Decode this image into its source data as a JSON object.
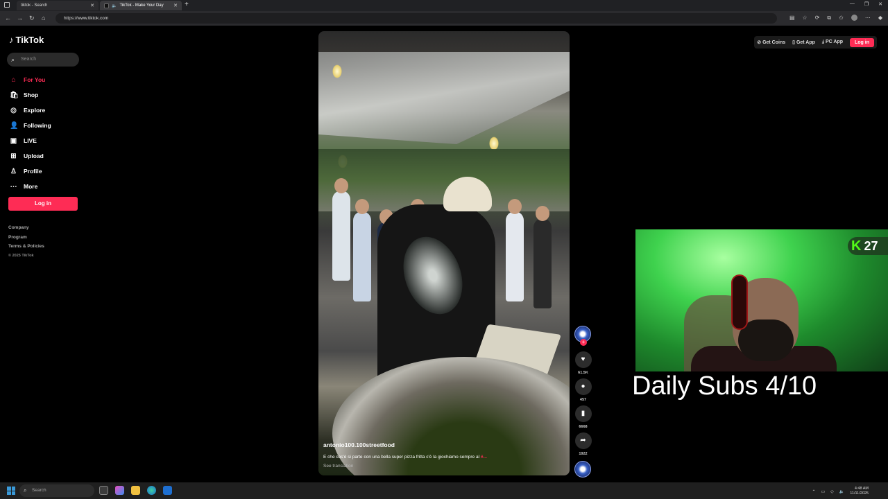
{
  "browser": {
    "tabs": [
      {
        "label": "tiktok - Search"
      },
      {
        "label": "TikTok - Make Your Day"
      }
    ],
    "url": "https://www.tiktok.com"
  },
  "tiktok": {
    "logo": "TikTok",
    "search_placeholder": "Search",
    "menu": [
      {
        "label": "For You",
        "icon": "home-icon"
      },
      {
        "label": "Shop",
        "icon": "shop-icon"
      },
      {
        "label": "Explore",
        "icon": "compass-icon"
      },
      {
        "label": "Following",
        "icon": "following-icon"
      },
      {
        "label": "LIVE",
        "icon": "live-icon"
      },
      {
        "label": "Upload",
        "icon": "upload-icon"
      },
      {
        "label": "Profile",
        "icon": "profile-icon"
      },
      {
        "label": "More",
        "icon": "more-icon"
      }
    ],
    "login_label": "Log in",
    "footer": {
      "company": "Company",
      "program": "Program",
      "terms": "Terms & Policies",
      "copyright": "© 2025 TikTok"
    },
    "header": {
      "get_coins": "Get Coins",
      "get_app": "Get App",
      "pc_app": "PC App",
      "login": "Log in"
    },
    "video": {
      "username": "antonio100.100streetfood",
      "caption": "E che cos'è si parte con una bella super pizza fritta c'è la giochiamo sempre al",
      "caption_tag": "#...",
      "see_translation": "See translation"
    },
    "actions": {
      "likes": "61.5K",
      "comments": "457",
      "saves": "6668",
      "shares": "1922"
    }
  },
  "stream": {
    "kick_viewers": "27",
    "overlay": "Daily Subs 4/10"
  },
  "taskbar": {
    "search_placeholder": "Search",
    "time": "4:48 AM",
    "date": "11/11/2025"
  },
  "colors": {
    "accent": "#fe2c55",
    "kick_green": "#53fc18"
  }
}
